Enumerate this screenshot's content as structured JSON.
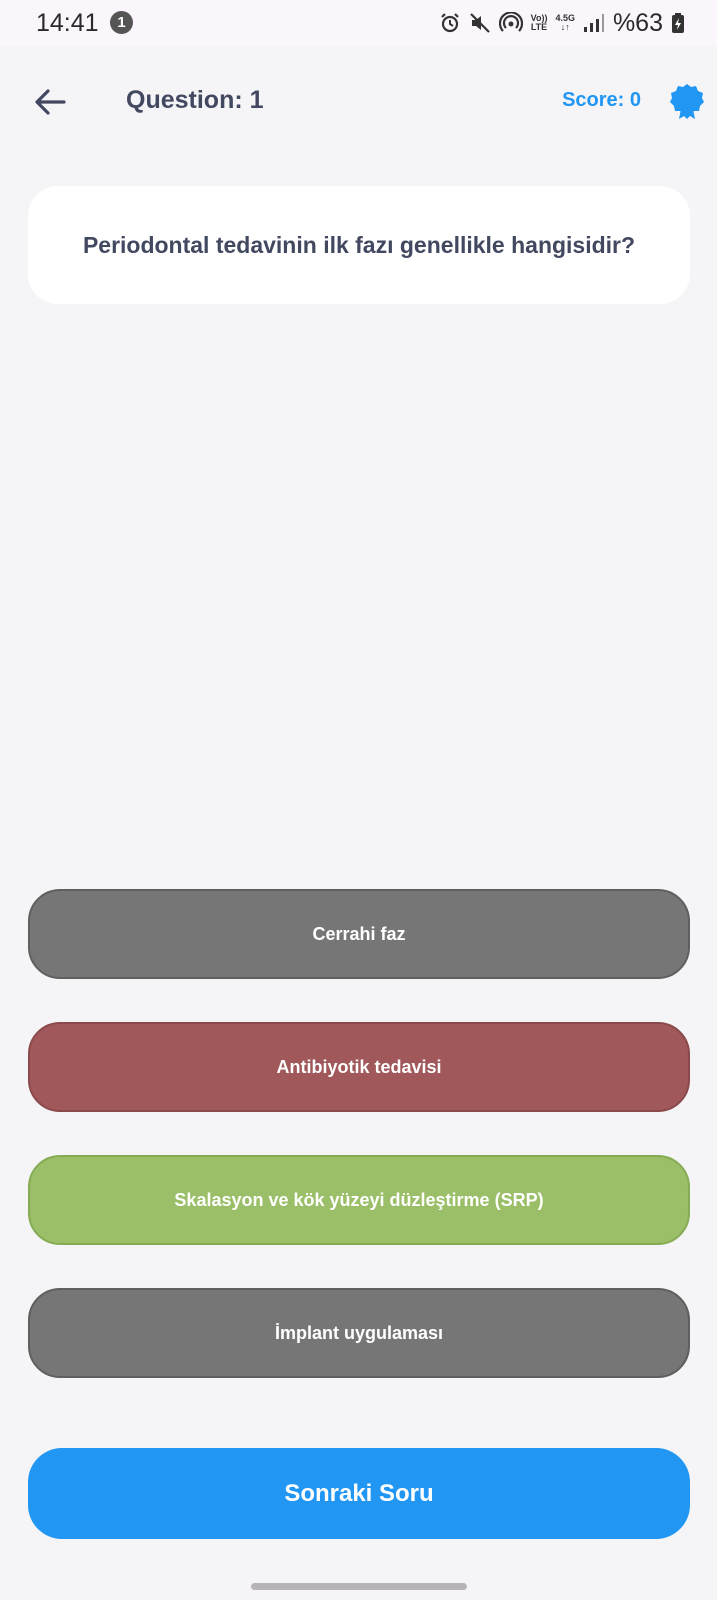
{
  "status_bar": {
    "time": "14:41",
    "notification_count": "1",
    "network_top": "Vo))",
    "network_bottom": "LTE",
    "data_type": "4.5G",
    "battery": "%63"
  },
  "header": {
    "title": "Question: 1",
    "score": "Score: 0"
  },
  "question": {
    "text": "Periodontal tedavinin ilk fazı genellikle hangisidir?"
  },
  "options": [
    {
      "label": "Cerrahi faz",
      "state": "neutral"
    },
    {
      "label": "Antibiyotik tedavisi",
      "state": "wrong"
    },
    {
      "label": "Skalasyon ve kök yüzeyi düzleştirme (SRP)",
      "state": "correct"
    },
    {
      "label": "İmplant uygulaması",
      "state": "neutral"
    }
  ],
  "next_button": {
    "label": "Sonraki Soru"
  },
  "colors": {
    "accent": "#2196f3",
    "correct": "#9bbf68",
    "wrong": "#a0585a",
    "neutral": "#767676",
    "title_text": "#434861"
  }
}
